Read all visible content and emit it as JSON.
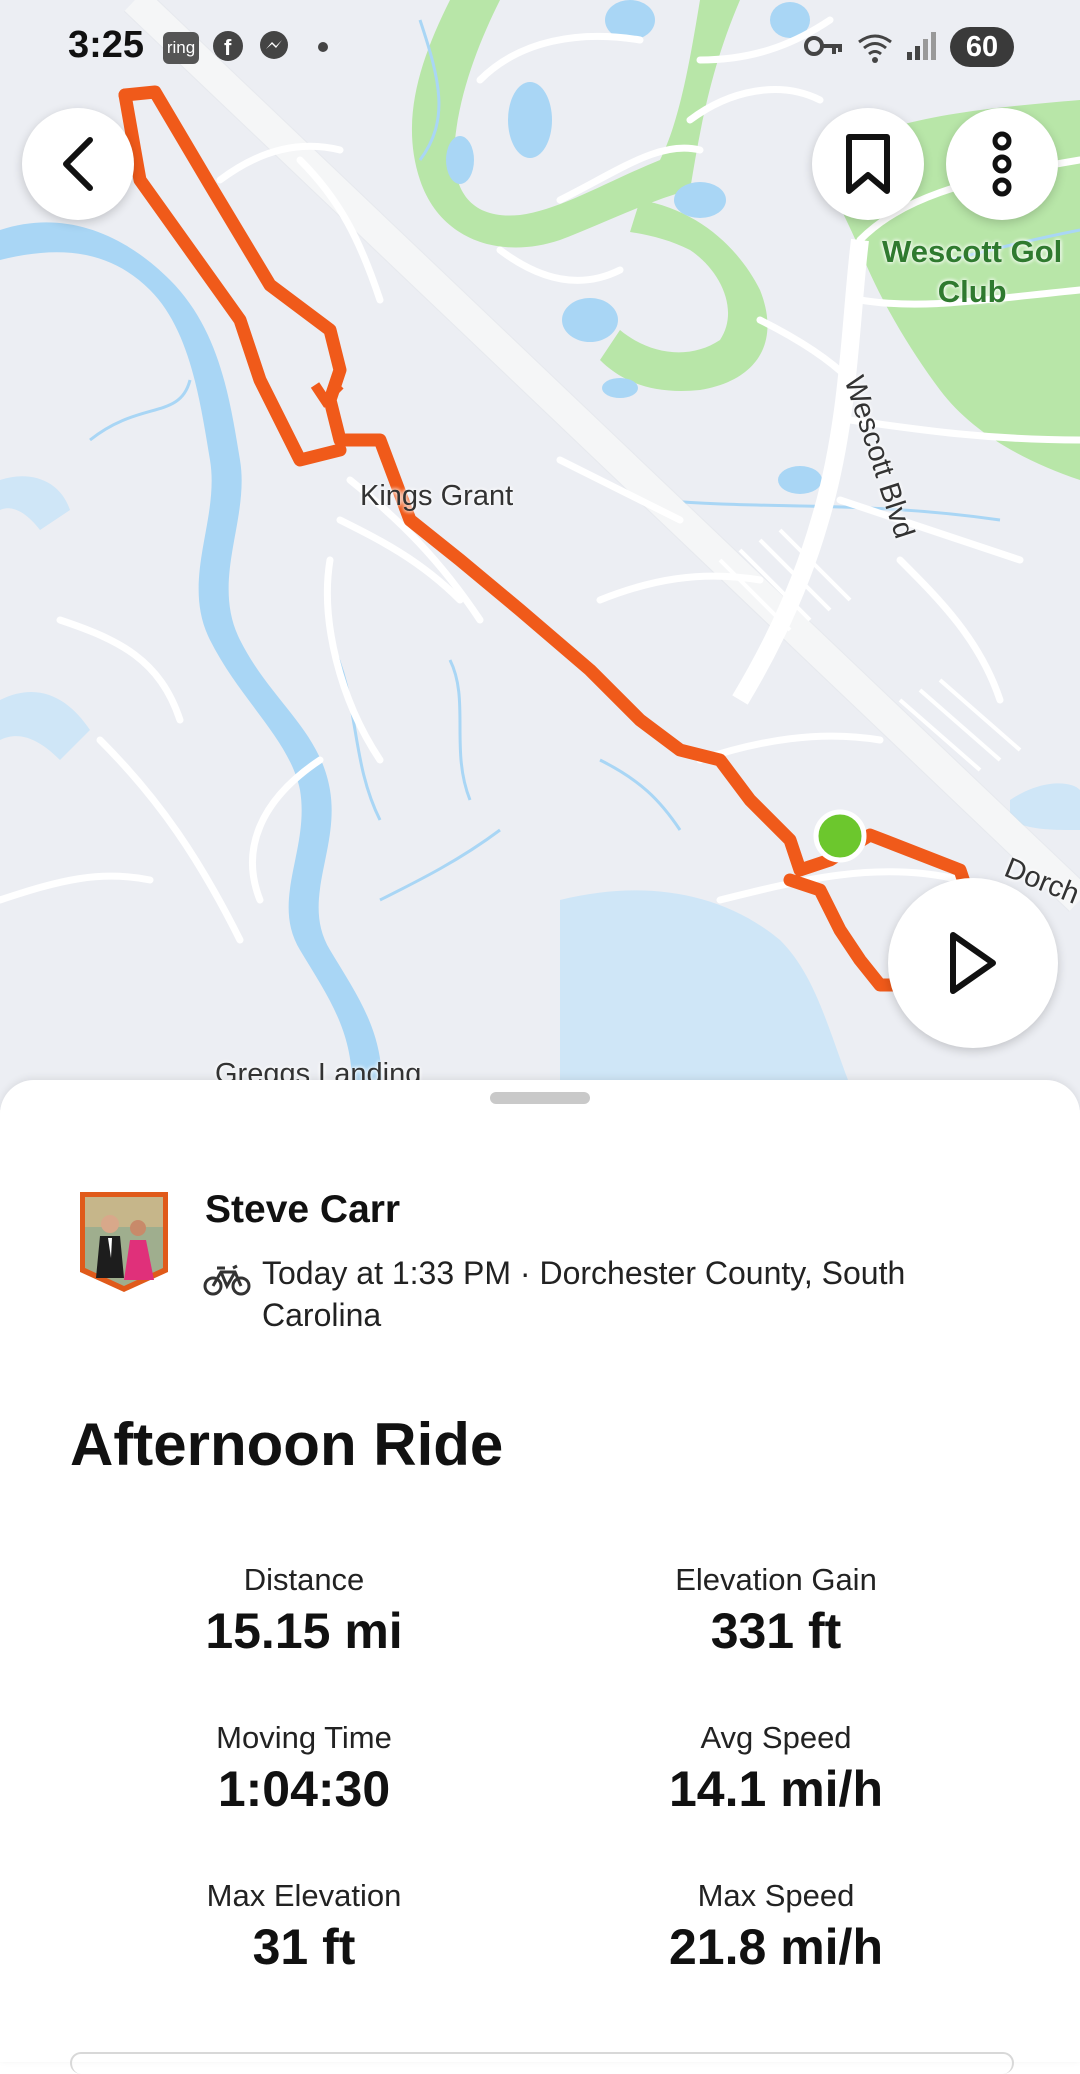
{
  "status_bar": {
    "time": "3:25",
    "ring_label": "ring",
    "battery": "60",
    "icons": [
      "ring-icon",
      "facebook-icon",
      "messenger-icon",
      "dot-icon",
      "key-icon",
      "wifi-icon",
      "signal-icon",
      "battery-icon"
    ]
  },
  "map": {
    "labels": {
      "kings_grant": "Kings Grant",
      "wescott_golf_line1": "Wescott Gol",
      "wescott_golf_line2": "Club",
      "wescott_blvd": "Wescott Blvd",
      "greggs_landing": "Greggs Landing",
      "dorchester": "Dorch"
    },
    "route_color": "#f05a1a",
    "start_marker_color": "#6cc72d",
    "water_color": "#a9d6f5",
    "park_color": "#b8e6a8"
  },
  "buttons": {
    "back": "back-icon",
    "bookmark": "bookmark-icon",
    "more": "more-vertical-icon",
    "play": "play-icon"
  },
  "activity": {
    "athlete_name": "Steve Carr",
    "meta": "Today at 1:33 PM · Dorchester County, South Carolina",
    "title": "Afternoon Ride",
    "stats": [
      {
        "label": "Distance",
        "value": "15.15 mi"
      },
      {
        "label": "Elevation Gain",
        "value": "331 ft"
      },
      {
        "label": "Moving Time",
        "value": "1:04:30"
      },
      {
        "label": "Avg Speed",
        "value": "14.1 mi/h"
      },
      {
        "label": "Max Elevation",
        "value": "31 ft"
      },
      {
        "label": "Max Speed",
        "value": "21.8 mi/h"
      }
    ]
  }
}
